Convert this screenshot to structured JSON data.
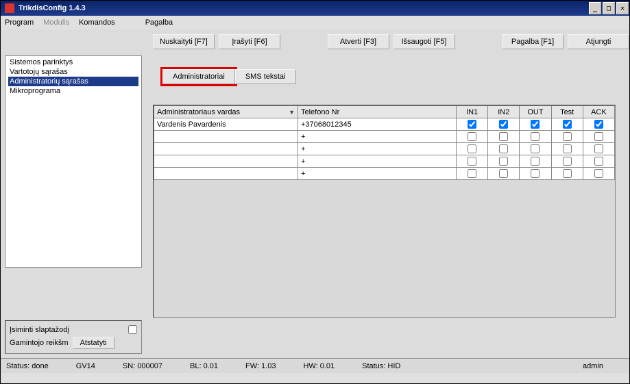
{
  "window": {
    "title": "TrikdisConfig 1.4.3"
  },
  "menu": {
    "program": "Program",
    "modulis": "Modulis",
    "komandos": "Komandos",
    "pagalba": "Pagalba"
  },
  "toolbar": {
    "read": "Nuskaityti [F7]",
    "write": "Įrašyti [F6]",
    "open": "Atverti [F3]",
    "save": "Išsaugoti [F5]",
    "help": "Pagalba [F1]",
    "disconnect": "Atjungti"
  },
  "sidebar": {
    "items": [
      "Sistemos parinktys",
      "Vartotojų sąrašas",
      "Administratorių sąrašas",
      "Mikroprograma"
    ],
    "selected_index": 2
  },
  "tabs": {
    "admin": "Administratoriai",
    "sms": "SMS tekstai"
  },
  "grid": {
    "headers": {
      "name": "Administratoriaus vardas",
      "phone": "Telefono Nr",
      "in1": "IN1",
      "in2": "IN2",
      "out": "OUT",
      "test": "Test",
      "ack": "ACK"
    },
    "rows": [
      {
        "name": "Vardenis Pavardenis",
        "phone": "+37068012345",
        "in1": true,
        "in2": true,
        "out": true,
        "test": true,
        "ack": true
      },
      {
        "name": "",
        "phone": "+",
        "in1": false,
        "in2": false,
        "out": false,
        "test": false,
        "ack": false
      },
      {
        "name": "",
        "phone": "+",
        "in1": false,
        "in2": false,
        "out": false,
        "test": false,
        "ack": false
      },
      {
        "name": "",
        "phone": "+",
        "in1": false,
        "in2": false,
        "out": false,
        "test": false,
        "ack": false
      },
      {
        "name": "",
        "phone": "+",
        "in1": false,
        "in2": false,
        "out": false,
        "test": false,
        "ack": false
      }
    ]
  },
  "bottom": {
    "remember": "Įsiminti slaptažodį",
    "default_label": "Gamintojo reikšm",
    "reset": "Atstatyti"
  },
  "status": {
    "status": "Status: done",
    "gv": "GV14",
    "sn": "SN: 000007",
    "bl": "BL: 0.01",
    "fw": "FW: 1.03",
    "hw": "HW: 0.01",
    "hid": "Status: HID",
    "user": "admin"
  }
}
